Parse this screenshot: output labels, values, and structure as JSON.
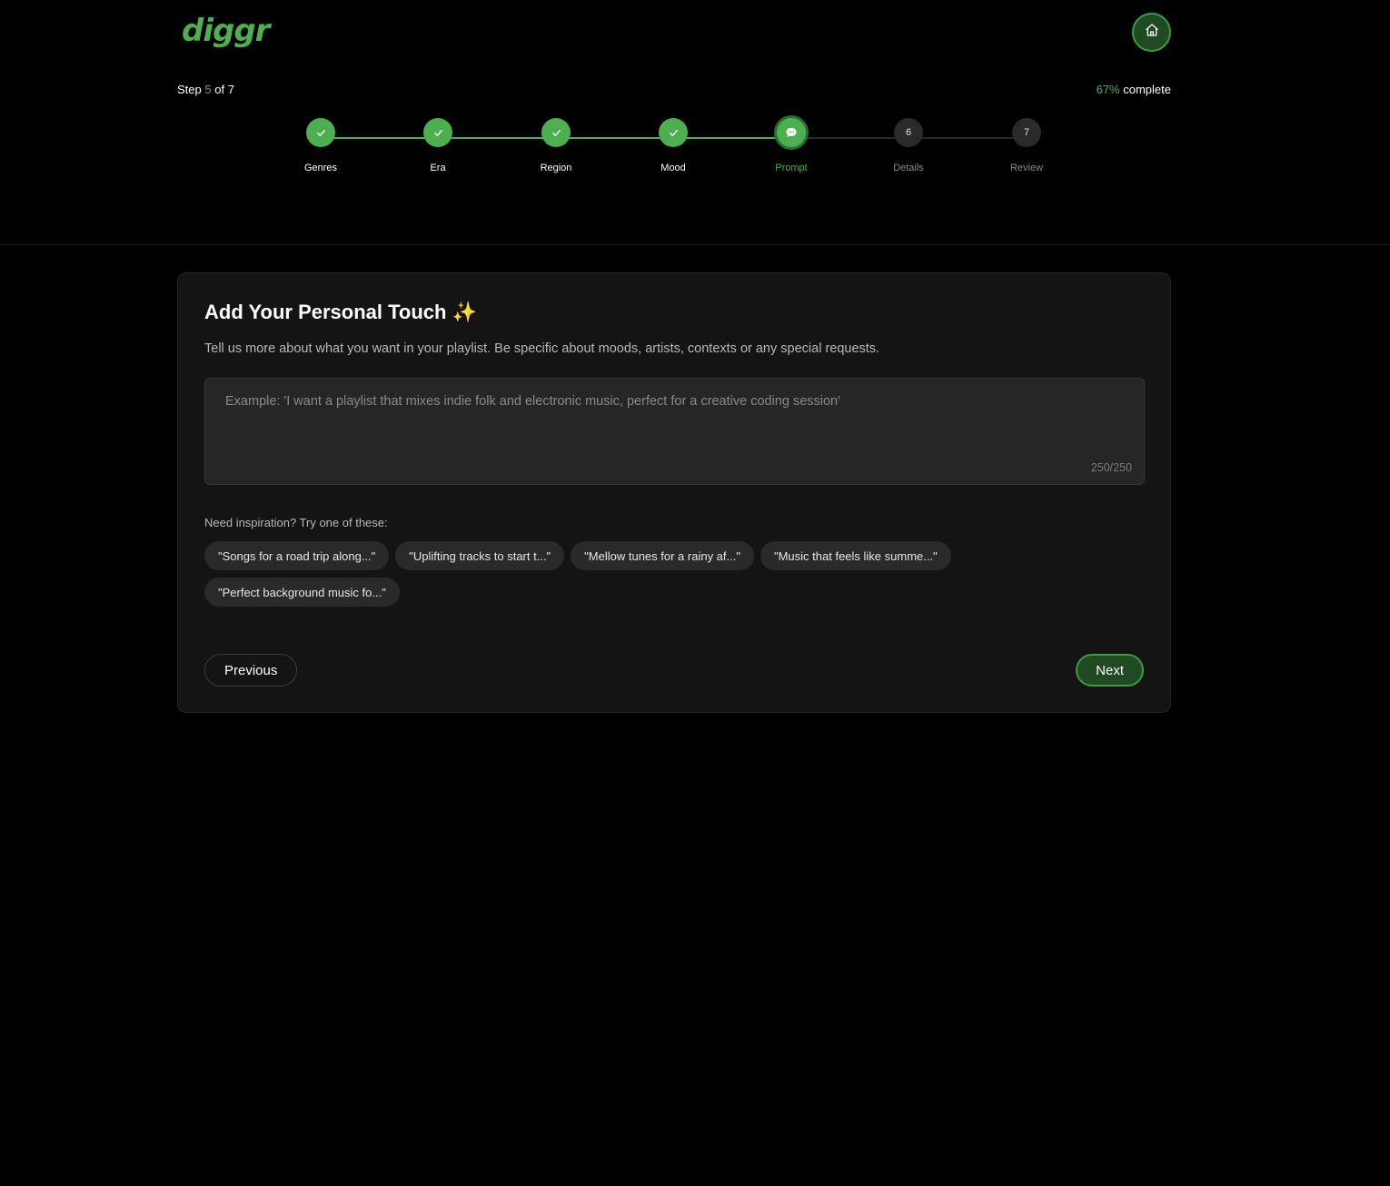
{
  "header": {
    "logo_text": "diggr",
    "home_icon": "home-icon"
  },
  "progress": {
    "step_prefix": "Step",
    "current_step": "5",
    "step_suffix": "of 7",
    "percent": "67%",
    "percent_suffix": "complete",
    "colors": {
      "accent": "#4caf50",
      "pending": "#2a2a2a"
    }
  },
  "steps": [
    {
      "label": "Genres",
      "state": "done",
      "icon": "check-icon"
    },
    {
      "label": "Era",
      "state": "done",
      "icon": "check-icon"
    },
    {
      "label": "Region",
      "state": "done",
      "icon": "check-icon"
    },
    {
      "label": "Mood",
      "state": "done",
      "icon": "check-icon"
    },
    {
      "label": "Prompt",
      "state": "current",
      "icon": "chat-bubble-icon"
    },
    {
      "label": "Details",
      "state": "todo",
      "number": "6"
    },
    {
      "label": "Review",
      "state": "todo",
      "number": "7"
    }
  ],
  "card": {
    "title": "Add Your Personal Touch ✨",
    "subtitle": "Tell us more about what you want in your playlist. Be specific about moods, artists, contexts or any special requests.",
    "prompt_placeholder": "Example: 'I want a playlist that mixes indie folk and electronic music, perfect for a creative coding session'",
    "prompt_value": "",
    "char_counter": "250/250",
    "inspiration_label": "Need inspiration? Try one of these:",
    "suggestions": [
      "\"Songs for a road trip along...\"",
      "\"Uplifting tracks to start t...\"",
      "\"Mellow tunes for a rainy af...\"",
      "\"Music that feels like summe...\"",
      "\"Perfect background music fo...\""
    ],
    "previous_label": "Previous",
    "next_label": "Next"
  }
}
